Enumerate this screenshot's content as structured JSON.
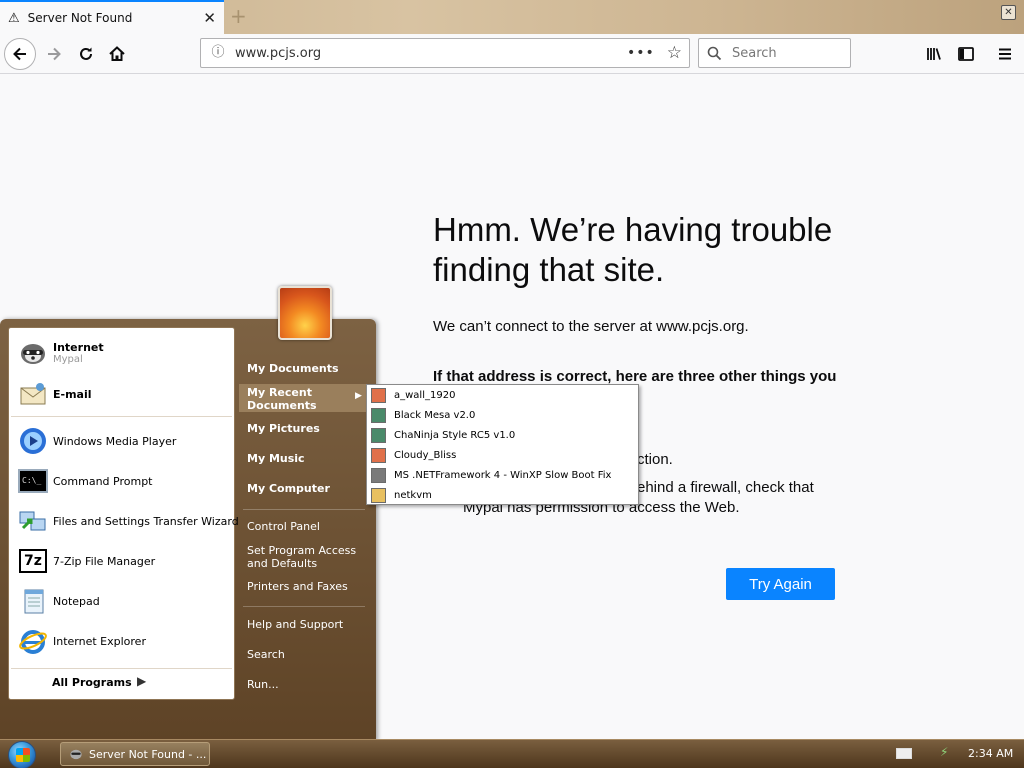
{
  "browser": {
    "tab": {
      "title": "Server Not Found",
      "close": "✕"
    },
    "new_tab": "+",
    "url": "www.pcjs.org",
    "url_more": "•••",
    "search_placeholder": "Search"
  },
  "error_page": {
    "title_line1": "Hmm. We’re having trouble",
    "title_line2": "finding that site.",
    "message": "We can’t connect to the server at www.pcjs.org.",
    "suggestions_heading": "If that address is correct, here are three other things you",
    "suggestion_fragment": "ction.",
    "firewall_line1": "ehind a firewall, check that",
    "firewall_line2": "Mypal has permission to access the Web.",
    "try_again": "Try Again"
  },
  "start_menu": {
    "pinned": [
      {
        "label": "Internet",
        "sub": "Mypal",
        "icon": "mypal-raccoon-icon"
      },
      {
        "label": "E-mail",
        "icon": "email-envelope-icon"
      }
    ],
    "recent_programs": [
      {
        "label": "Windows Media Player",
        "icon": "media-player-icon"
      },
      {
        "label": "Command Prompt",
        "icon": "command-prompt-icon",
        "icon_text": "C:\\_"
      },
      {
        "label": "Files and Settings Transfer Wizard",
        "icon": "transfer-wizard-icon"
      },
      {
        "label": "7-Zip File Manager",
        "icon": "7zip-icon",
        "icon_text": "7z"
      },
      {
        "label": "Notepad",
        "icon": "notepad-icon"
      },
      {
        "label": "Internet Explorer",
        "icon": "internet-explorer-icon"
      }
    ],
    "all_programs": "All Programs",
    "right_items": {
      "my_documents": "My Documents",
      "my_recent_documents_1": "My Recent",
      "my_recent_documents_2": "Documents",
      "my_pictures": "My Pictures",
      "my_music": "My Music",
      "my_computer": "My Computer",
      "control_panel": "Control Panel",
      "set_program_access_1": "Set Program Access",
      "set_program_access_2": "and Defaults",
      "printers_and_faxes": "Printers and Faxes",
      "help_and_support": "Help and Support",
      "search": "Search",
      "run": "Run..."
    },
    "recent_documents": [
      {
        "label": "a_wall_1920",
        "color": "#e0704a"
      },
      {
        "label": "Black Mesa v2.0",
        "color": "#4a8a6a"
      },
      {
        "label": "ChaNinja Style RC5 v1.0",
        "color": "#4a8a6a"
      },
      {
        "label": "Cloudy_Bliss",
        "color": "#e0704a"
      },
      {
        "label": "MS .NETFramework 4 - WinXP Slow Boot Fix",
        "color": "#7a7a7a"
      },
      {
        "label": "netkvm",
        "color": "#e8c060"
      }
    ]
  },
  "taskbar": {
    "task_label": "Server Not Found - ...",
    "clock": "2:34 AM"
  }
}
